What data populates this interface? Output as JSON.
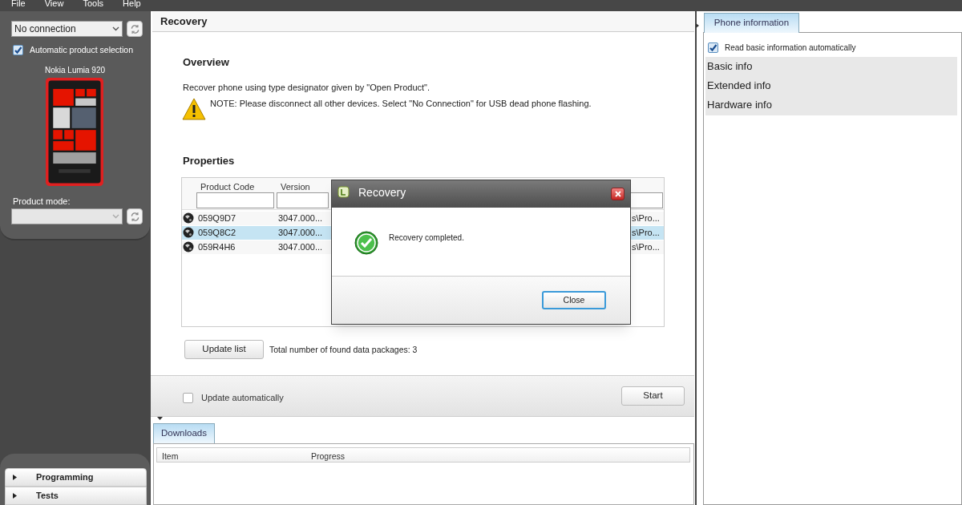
{
  "menu": [
    "File",
    "View",
    "Tools",
    "Help"
  ],
  "sidebar": {
    "connection": {
      "value": "No connection"
    },
    "auto_select": {
      "label": "Automatic product selection",
      "checked": true
    },
    "product_name": "Nokia Lumia 920",
    "product_mode": {
      "label": "Product mode:"
    },
    "nav": [
      {
        "label": "Programming",
        "expanded": false
      },
      {
        "label": "Tests",
        "expanded": false
      }
    ]
  },
  "main": {
    "title": "Recovery",
    "overview": {
      "heading": "Overview",
      "text": "Recover phone using type designator given by \"Open Product\".",
      "note": "NOTE: Please disconnect all other devices. Select \"No Connection\" for USB dead phone flashing."
    },
    "properties": {
      "heading": "Properties",
      "columns": [
        "Product Code",
        "Version"
      ],
      "rows": [
        {
          "product_code": "059Q9D7",
          "version": "3047.000...",
          "column_3": "s\\Pro...",
          "selected": false
        },
        {
          "product_code": "059Q8C2",
          "version": "3047.000...",
          "column_3": "s\\Pro...",
          "selected": true
        },
        {
          "product_code": "059R4H6",
          "version": "3047.000...",
          "column_3": "s\\Pro...",
          "selected": false
        }
      ]
    },
    "update_button": "Update list",
    "total": "Total number of found data packages: 3",
    "update_auto": {
      "label": "Update automatically",
      "checked": false
    },
    "start_button": "Start"
  },
  "downloads": {
    "tab": "Downloads",
    "columns": [
      "Item",
      "Progress"
    ]
  },
  "phone_info": {
    "tab": "Phone information",
    "read_auto": {
      "label": "Read basic information automatically",
      "checked": true
    },
    "items": [
      "Basic info",
      "Extended info",
      "Hardware info"
    ]
  },
  "dialog": {
    "title": "Recovery",
    "message": "Recovery completed.",
    "button": "Close"
  }
}
